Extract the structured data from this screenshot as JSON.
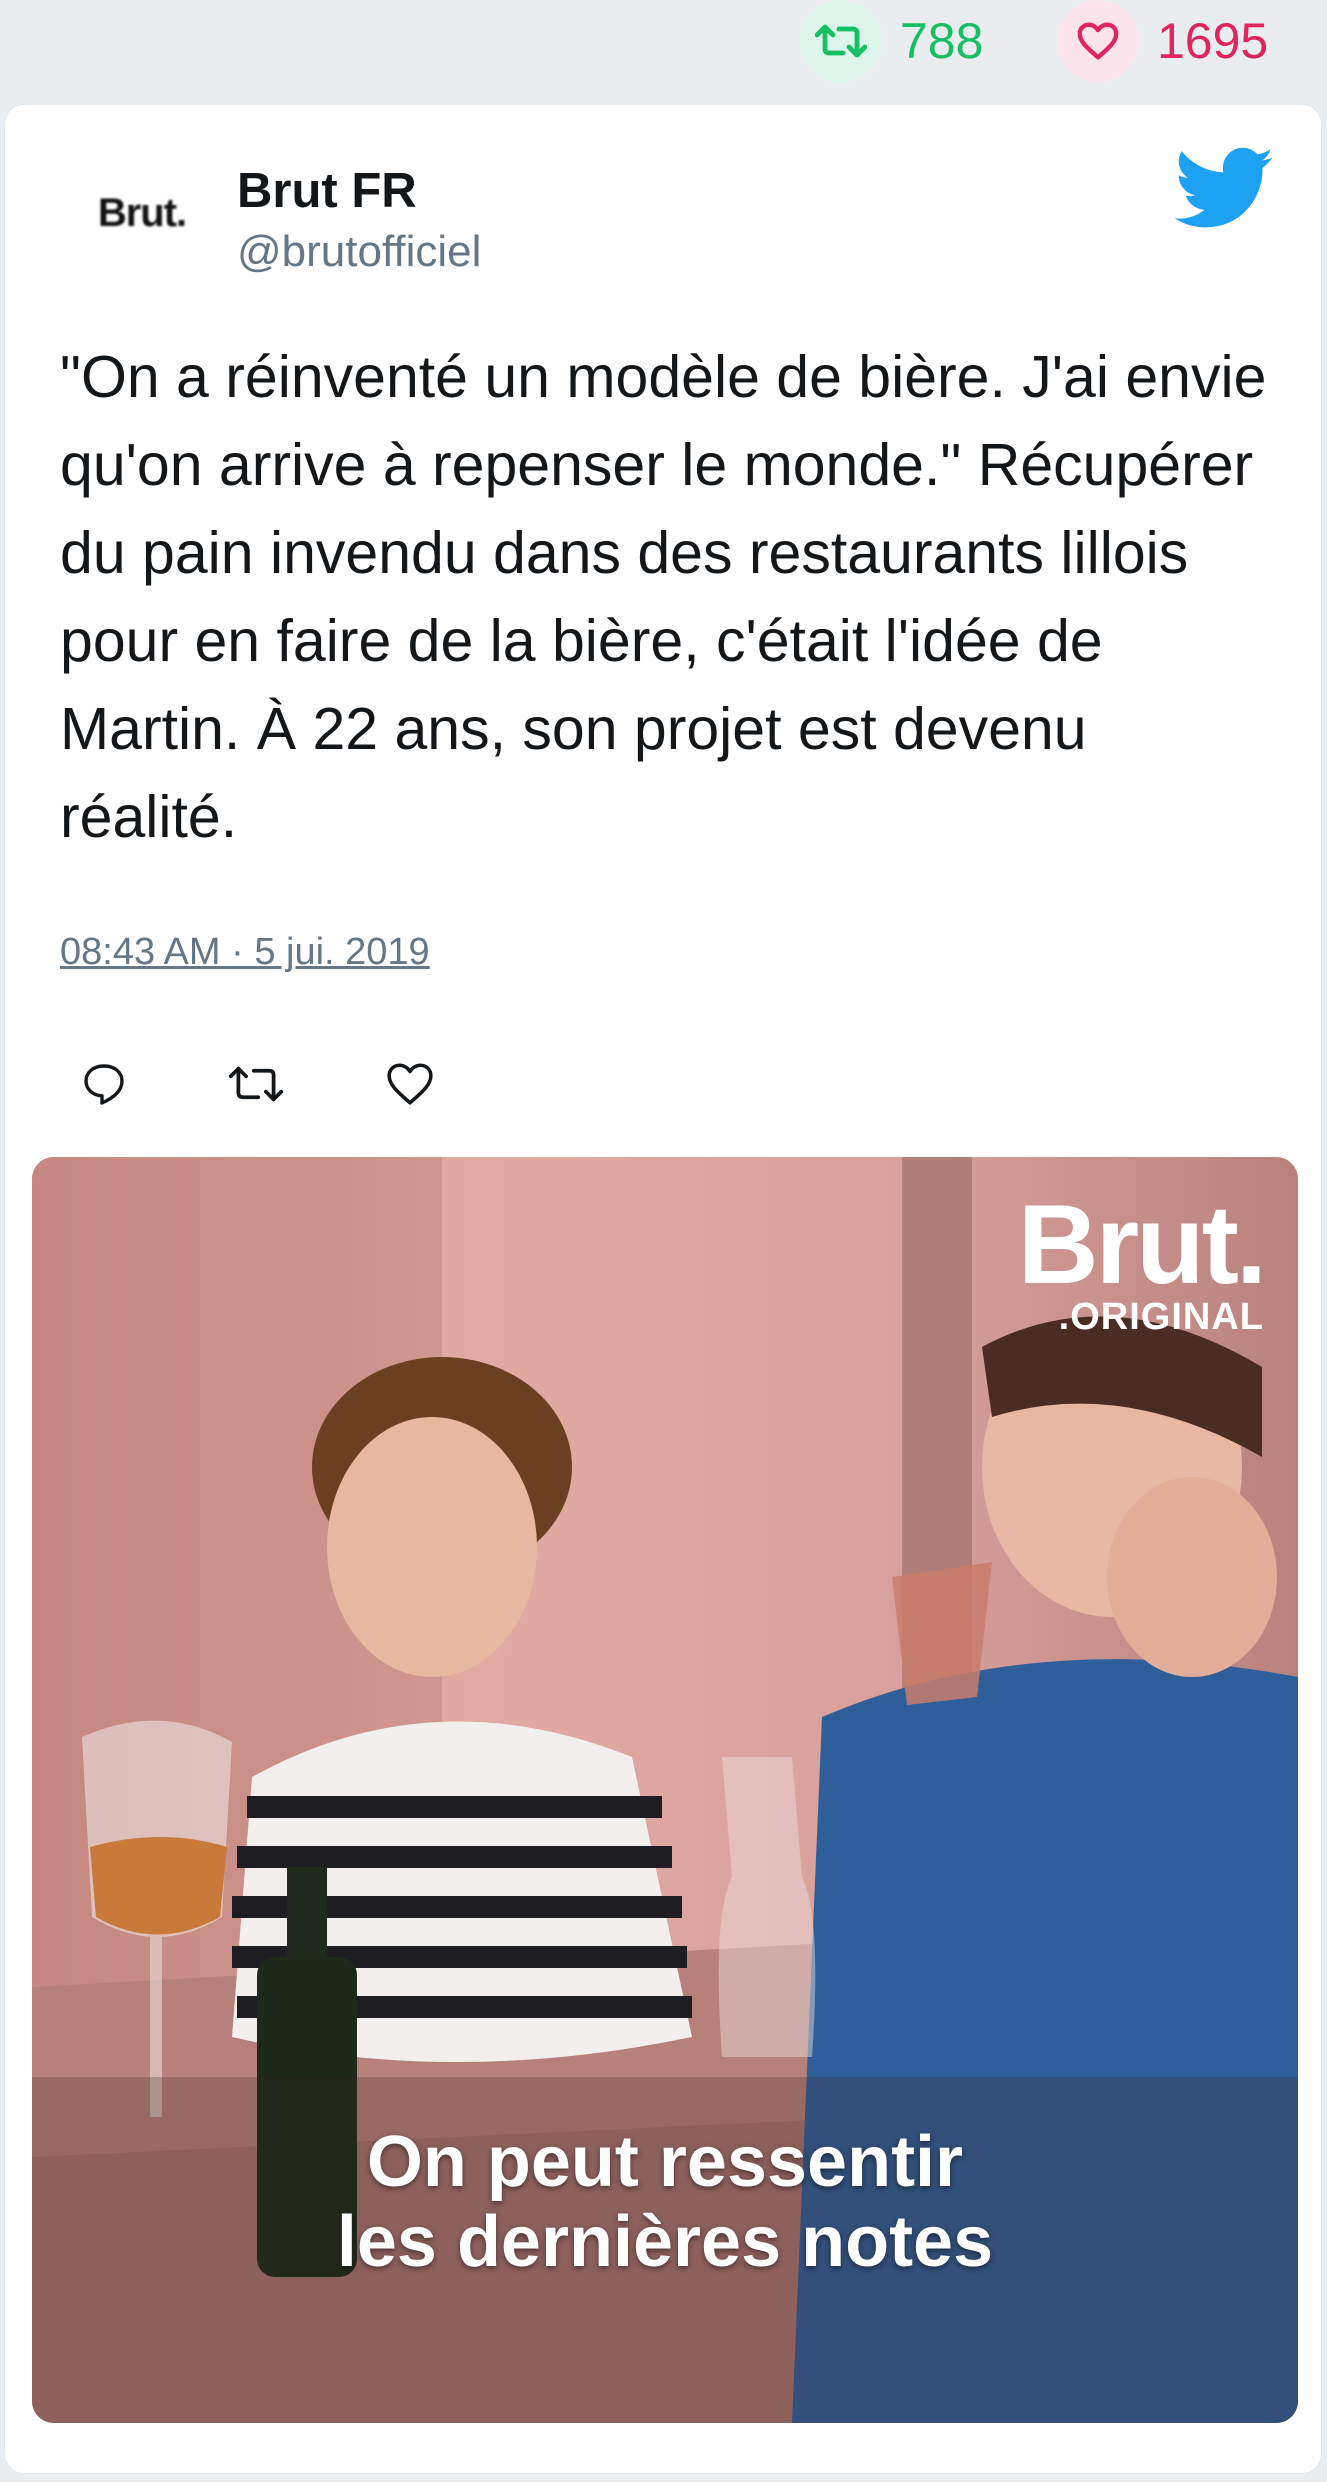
{
  "stats": {
    "retweets": "788",
    "likes": "1695",
    "retweet_color": "#17bf63",
    "like_color": "#e0245e"
  },
  "tweet": {
    "avatar_text": "Brut.",
    "author_name": "Brut FR",
    "author_handle": "@brutofficiel",
    "text": "\"On a réinventé un modèle de bière. J'ai envie qu'on arrive à repenser le monde.\" Récupérer du pain invendu dans des restaurants lillois pour en faire de la bière, c'était l'idée de Martin. À 22 ans, son projet est devenu réalité.",
    "timestamp": "08:43 AM · 5 jui. 2019",
    "icons": [
      "reply-icon",
      "retweet-icon",
      "like-icon",
      "twitter-bird-icon"
    ],
    "brand_color": "#1da1f2"
  },
  "media": {
    "logo_main": "Brut.",
    "logo_sub": ".ORIGINAL",
    "caption_line1": "On peut ressentir",
    "caption_line2": "les dernières notes"
  }
}
